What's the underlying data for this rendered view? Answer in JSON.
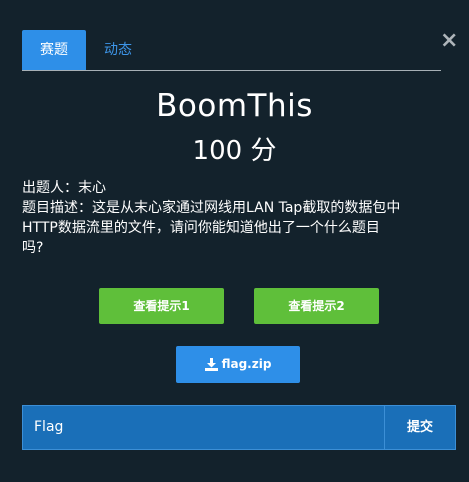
{
  "modal": {
    "close_glyph": "×",
    "tabs": [
      {
        "label": "赛题",
        "active": true
      },
      {
        "label": "动态",
        "active": false
      }
    ]
  },
  "challenge": {
    "name": "BoomThis",
    "points": "100 分",
    "author_line": "出题人：末心",
    "description_lines": [
      "题目描述：这是从末心家通过网线用LAN Tap截取的数据包中",
      "HTTP数据流里的文件，请问你能知道他出了一个什么题目",
      "吗?"
    ]
  },
  "hints": [
    {
      "label": "查看提示1"
    },
    {
      "label": "查看提示2"
    }
  ],
  "download": {
    "label": "flag.zip",
    "icon": "download-icon"
  },
  "flag_form": {
    "placeholder": "Flag",
    "submit_label": "提交"
  },
  "colors": {
    "background": "#13222c",
    "accent": "#2e8fe8",
    "hint_green": "#5fbf3a",
    "input_blue": "#1a6fb8"
  }
}
